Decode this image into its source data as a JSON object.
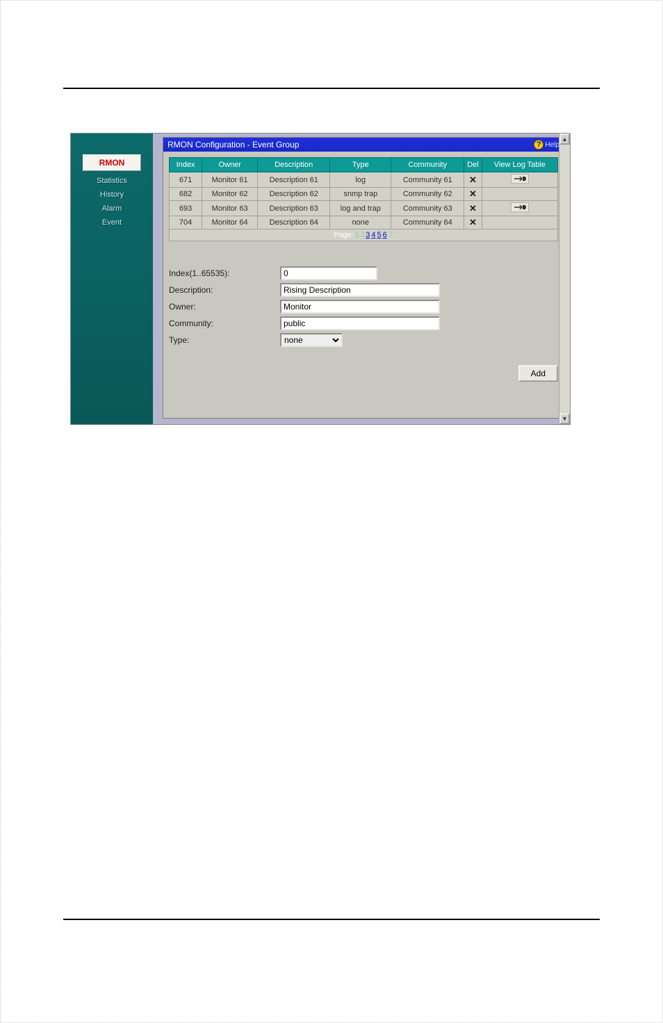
{
  "sidebar": {
    "header": "RMON",
    "items": [
      "Statistics",
      "History",
      "Alarm",
      "Event"
    ]
  },
  "titlebar": {
    "title": "RMON Configuration - Event Group",
    "help_label": "Help"
  },
  "table": {
    "headers": {
      "index": "Index",
      "owner": "Owner",
      "description": "Description",
      "type": "Type",
      "community": "Community",
      "del": "Del",
      "viewlog": "View Log Table"
    },
    "rows": [
      {
        "index": "671",
        "owner": "Monitor 61",
        "description": "Description 61",
        "type": "log",
        "community": "Community 61",
        "has_log": true
      },
      {
        "index": "682",
        "owner": "Monitor 62",
        "description": "Description 62",
        "type": "snmp trap",
        "community": "Community 62",
        "has_log": false
      },
      {
        "index": "693",
        "owner": "Monitor 63",
        "description": "Description 63",
        "type": "log and trap",
        "community": "Community 63",
        "has_log": true
      },
      {
        "index": "704",
        "owner": "Monitor 64",
        "description": "Description 64",
        "type": "none",
        "community": "Community 64",
        "has_log": false
      }
    ],
    "pager": {
      "label": "Page:",
      "pages_dim_pre": [
        "1",
        "2"
      ],
      "pages_links": [
        "3",
        "4",
        "5",
        "6"
      ],
      "pages_dim_post": [
        "7"
      ]
    }
  },
  "form": {
    "index_label": "Index(1..65535):",
    "index_value": "0",
    "description_label": "Description:",
    "description_value": "Rising Description",
    "owner_label": "Owner:",
    "owner_value": "Monitor",
    "community_label": "Community:",
    "community_value": "public",
    "type_label": "Type:",
    "type_value": "none"
  },
  "buttons": {
    "add": "Add"
  }
}
